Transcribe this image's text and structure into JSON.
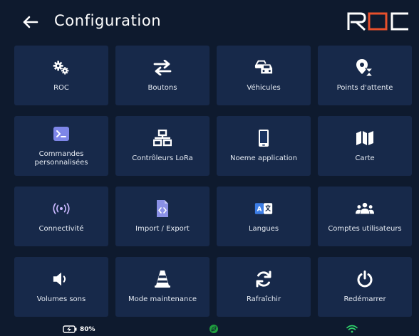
{
  "header": {
    "title": "Configuration",
    "logo_text": "ROC"
  },
  "tiles": [
    {
      "label": "ROC",
      "icon": "gears-icon"
    },
    {
      "label": "Boutons",
      "icon": "swap-arrows-icon"
    },
    {
      "label": "Véhicules",
      "icon": "cars-icon"
    },
    {
      "label": "Points d'attente",
      "icon": "map-pin-hourglass-icon"
    },
    {
      "label": "Commandes personnalisées",
      "icon": "terminal-icon"
    },
    {
      "label": "Contrôleurs LoRa",
      "icon": "network-icon"
    },
    {
      "label": "Noeme application",
      "icon": "tablet-icon"
    },
    {
      "label": "Carte",
      "icon": "map-icon"
    },
    {
      "label": "Connectivité",
      "icon": "broadcast-icon"
    },
    {
      "label": "Import / Export",
      "icon": "code-file-icon"
    },
    {
      "label": "Langues",
      "icon": "language-icon"
    },
    {
      "label": "Comptes utilisateurs",
      "icon": "users-icon"
    },
    {
      "label": "Volumes sons",
      "icon": "volume-icon"
    },
    {
      "label": "Mode maintenance",
      "icon": "traffic-cone-icon"
    },
    {
      "label": "Rafraîchir",
      "icon": "refresh-icon"
    },
    {
      "label": "Redémarrer",
      "icon": "power-icon"
    }
  ],
  "status": {
    "battery": "80%"
  },
  "colors": {
    "background": "#0e1a2e",
    "tile": "#17294a",
    "accent": "#e8502c",
    "wifi": "#2fd36b",
    "leaf": "#1f9e3e"
  }
}
